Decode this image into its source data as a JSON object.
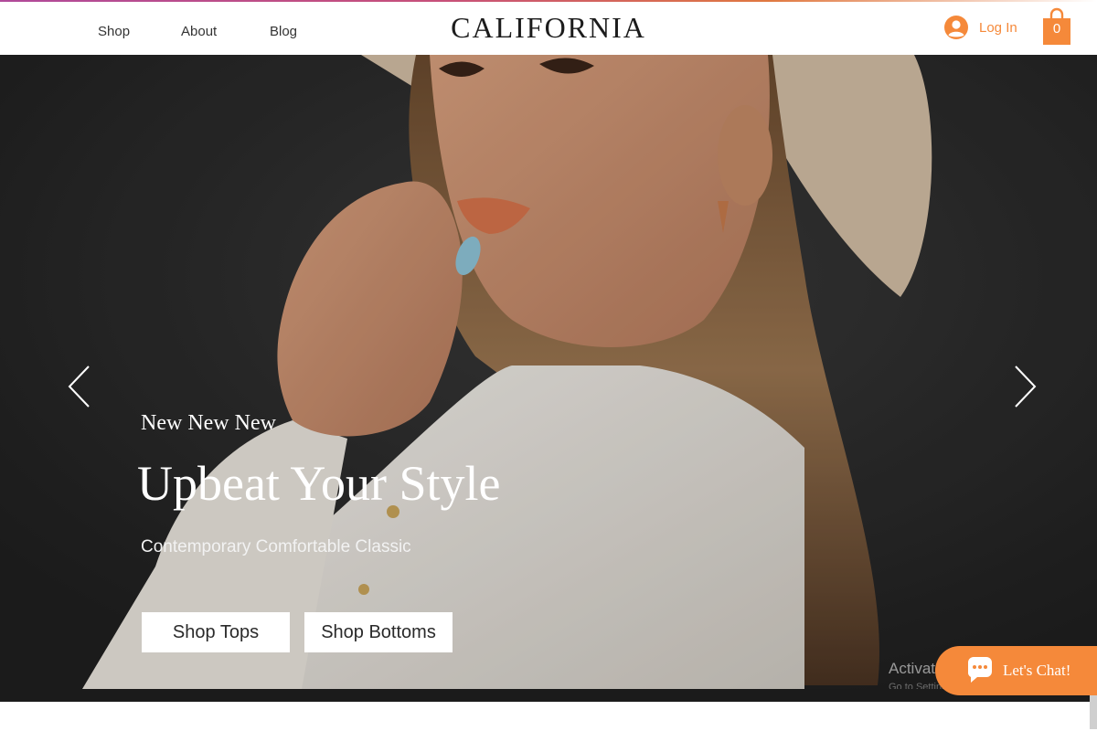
{
  "header": {
    "nav": [
      "Shop",
      "About",
      "Blog"
    ],
    "logo": "CALIFORNIA",
    "login_label": "Log In",
    "cart_count": "0"
  },
  "hero": {
    "eyebrow": "New New New",
    "headline": "Upbeat Your Style",
    "subline": "Contemporary Comfortable Classic",
    "buttons": [
      "Shop Tops",
      "Shop Bottoms"
    ]
  },
  "overlay": {
    "activate_text": "Activate",
    "activate_sub": "Go to Settings"
  },
  "chat": {
    "label": "Let's Chat!"
  },
  "colors": {
    "accent": "#f5893a",
    "hero_bg": "#262626",
    "header_bg": "#ffffff"
  },
  "icons": [
    "avatar-icon",
    "shopping-bag-icon",
    "chevron-left-icon",
    "chevron-right-icon",
    "chat-bubble-icon"
  ]
}
